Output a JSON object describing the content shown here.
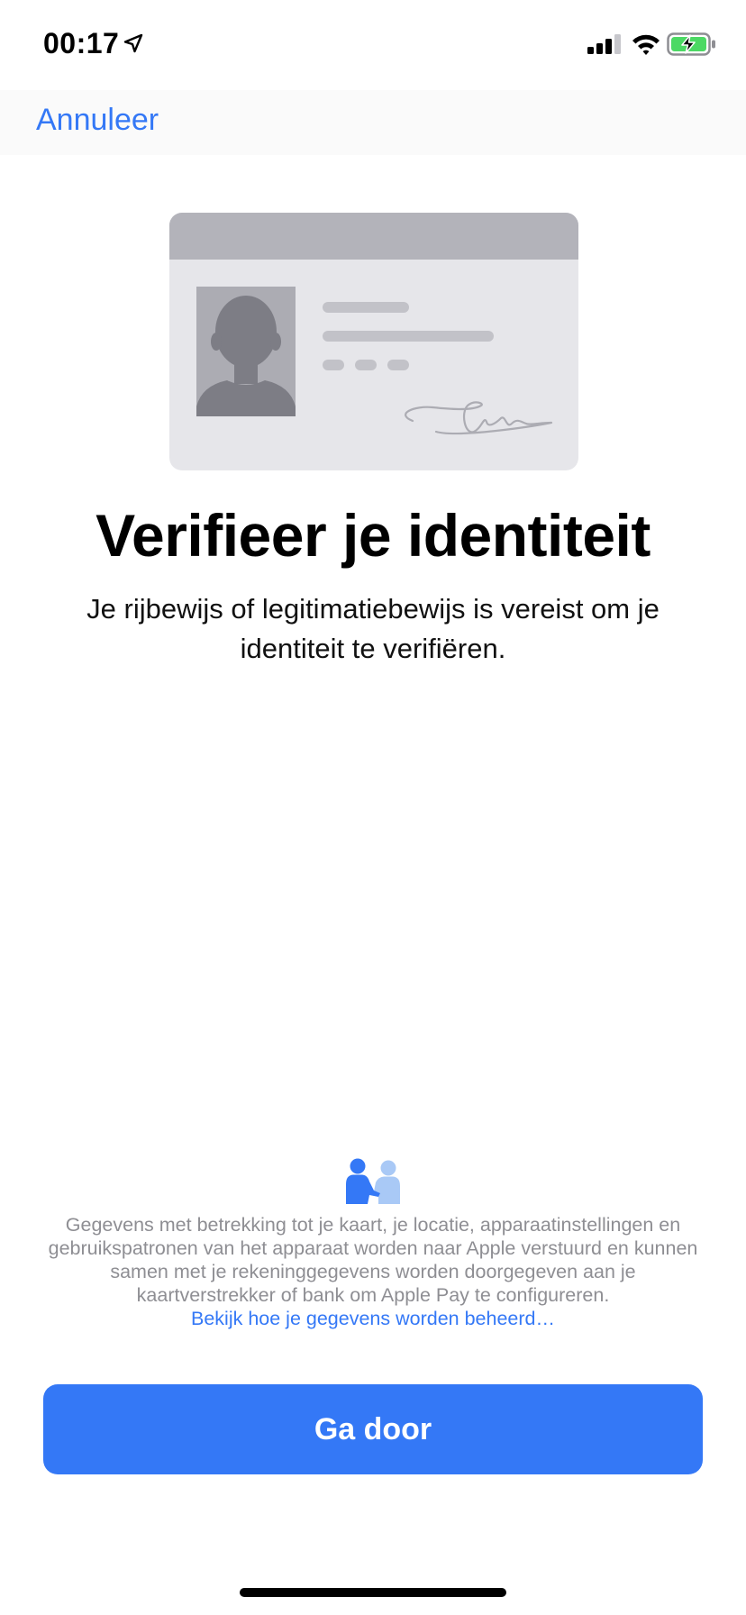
{
  "status_bar": {
    "time": "00:17"
  },
  "nav": {
    "cancel_label": "Annuleer"
  },
  "main": {
    "title": "Verifieer je identiteit",
    "subtitle": "Je rijbewijs of legitimatiebewijs is vereist om je identiteit te verifiëren."
  },
  "privacy": {
    "text": "Gegevens met betrekking tot je kaart, je locatie, apparaatinstellingen en gebruikspatronen van het apparaat worden naar Apple verstuurd en kunnen samen met je rekeninggegevens worden doorgegeven aan je kaartverstrekker of bank om Apple Pay te configureren.",
    "link_label": "Bekijk hoe je gegevens worden beheerd…"
  },
  "footer": {
    "continue_label": "Ga door"
  },
  "colors": {
    "accent": "#3478f6",
    "secondary_text": "#8e8e93",
    "battery_fill": "#4cd964"
  },
  "icons": {
    "location": "location-arrow-icon",
    "signal": "cellular-signal-icon",
    "wifi": "wifi-icon",
    "battery": "battery-charging-icon",
    "privacy": "privacy-handshake-icon",
    "id_card": "id-card-illustration"
  }
}
